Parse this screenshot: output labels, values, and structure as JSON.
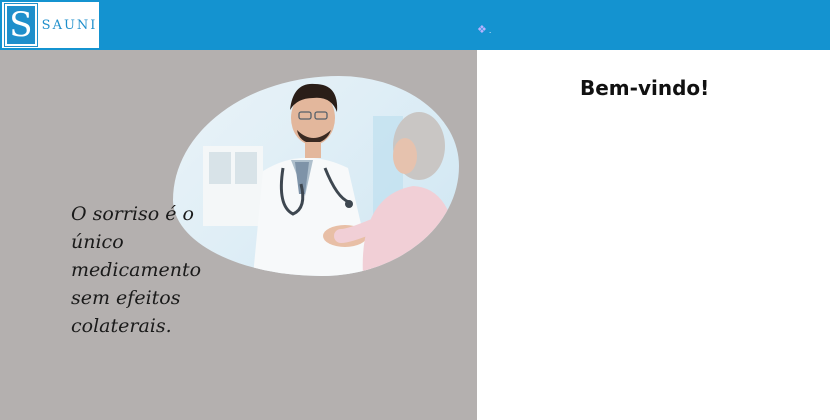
{
  "header": {
    "logo_letter": "S",
    "logo_text": "SAUNI",
    "nav_glyph": "❖",
    "nav_dot": "."
  },
  "hero": {
    "quote_lines": [
      "O sorriso é o",
      "único",
      "medicamento",
      "sem efeitos",
      "colaterais."
    ]
  },
  "welcome": {
    "title": "Bem-vindo!"
  },
  "colors": {
    "header_bg": "#1493d0",
    "panel_bg": "#b4b0af",
    "welcome_bg": "#ffffff"
  }
}
